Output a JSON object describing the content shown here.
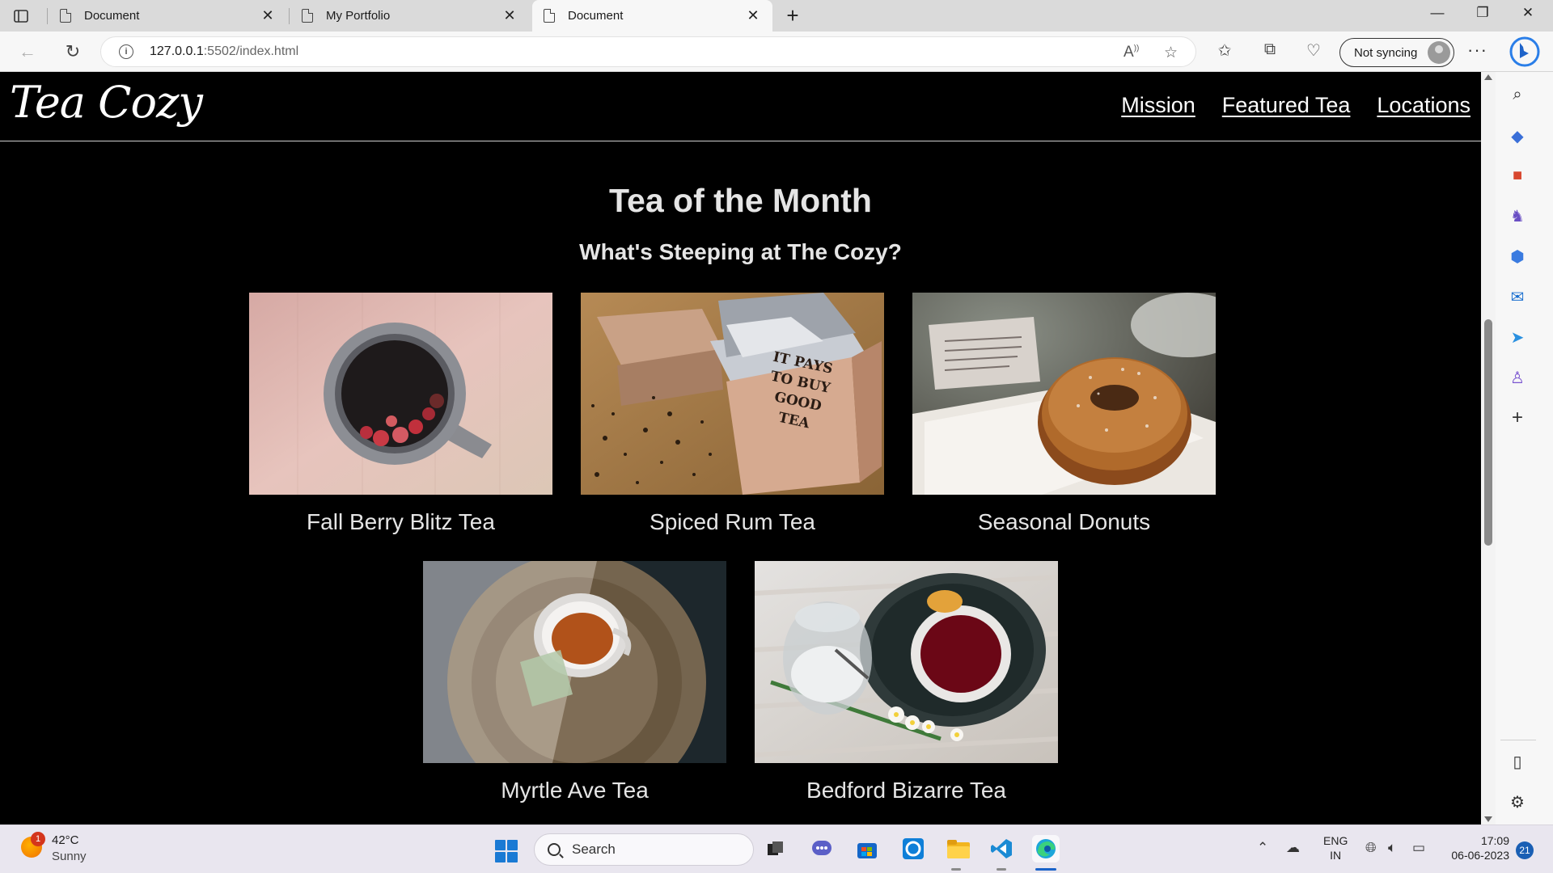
{
  "browser": {
    "tabs": [
      {
        "title": "Document",
        "close": "✕"
      },
      {
        "title": "My Portfolio",
        "close": "✕"
      },
      {
        "title": "Document",
        "close": "✕"
      }
    ],
    "new_tab": "+",
    "address": {
      "host": "127.0.0.1",
      "path": ":5502/index.html"
    },
    "sync_label": "Not syncing",
    "window_controls": {
      "minimize": "—",
      "maximize": "❐",
      "close": "✕"
    }
  },
  "site": {
    "logo": "Tea Cozy",
    "nav": [
      "Mission",
      "Featured Tea",
      "Locations"
    ],
    "section_title": "Tea of the Month",
    "section_subtitle": "What's Steeping at The Cozy?",
    "items": [
      {
        "caption": "Fall Berry Blitz Tea"
      },
      {
        "caption": "Spiced Rum Tea"
      },
      {
        "caption": "Seasonal Donuts"
      },
      {
        "caption": "Myrtle Ave Tea"
      },
      {
        "caption": "Bedford Bizarre Tea"
      }
    ],
    "box_sign": [
      "IT PAYS",
      "TO BUY",
      "GOOD",
      "TEA"
    ]
  },
  "taskbar": {
    "weather": {
      "temp": "42°C",
      "condition": "Sunny",
      "badge": "1"
    },
    "search_placeholder": "Search",
    "lang": [
      "ENG",
      "IN"
    ],
    "time": "17:09",
    "date": "06-06-2023",
    "notifications": "21"
  }
}
